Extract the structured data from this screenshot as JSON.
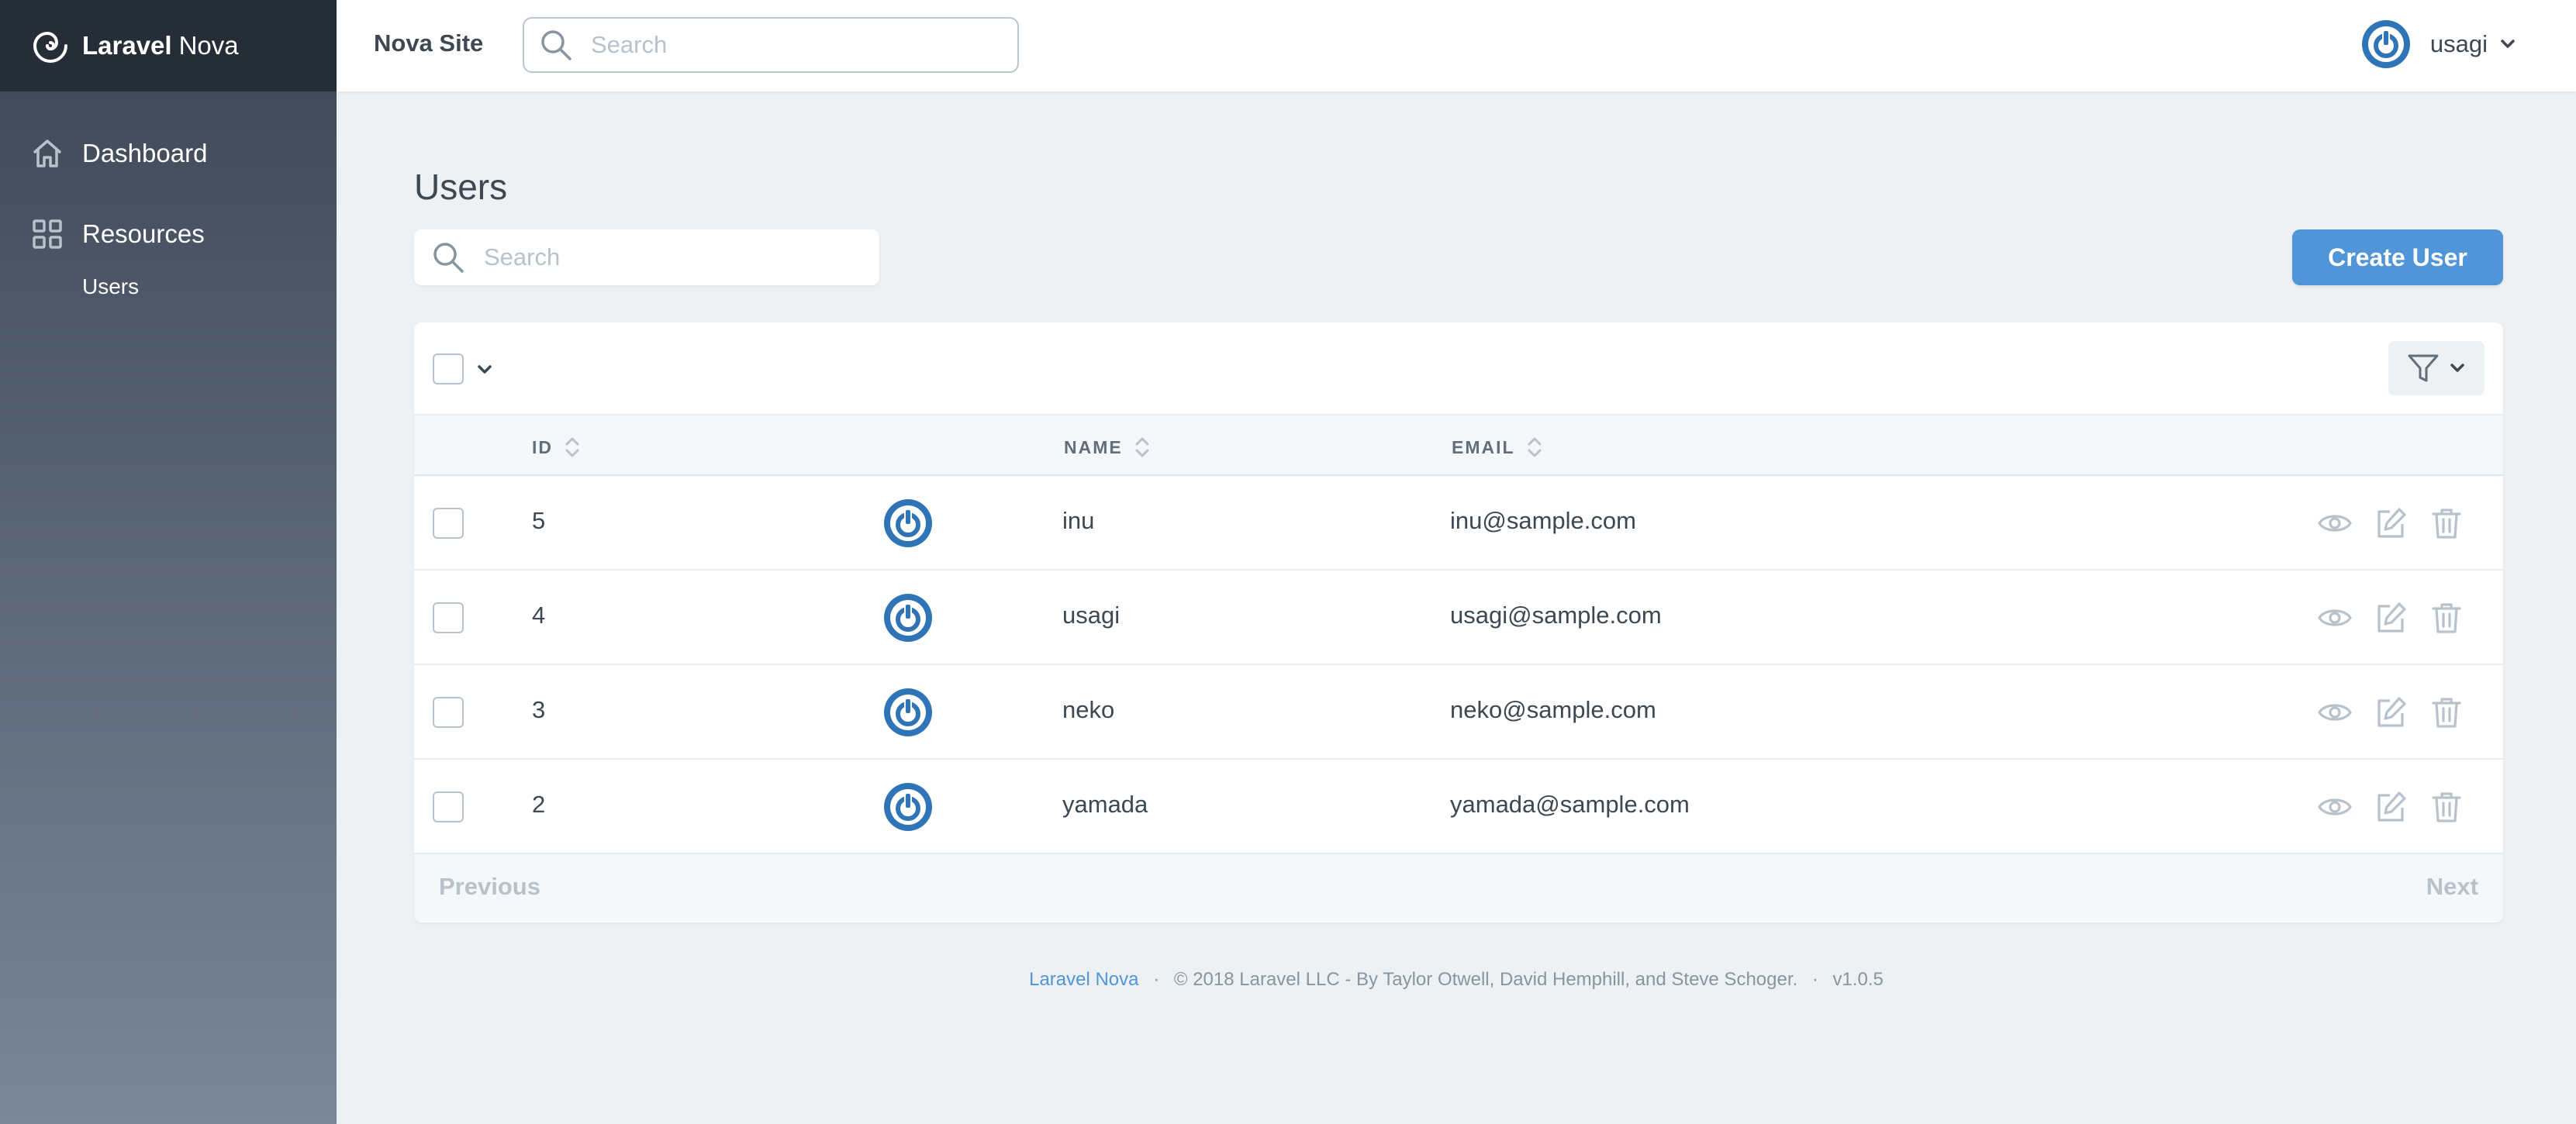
{
  "brand": {
    "name_bold": "Laravel",
    "name_light": "Nova"
  },
  "sidebar": {
    "items": [
      {
        "label": "Dashboard",
        "icon": "home-icon"
      },
      {
        "label": "Resources",
        "icon": "grid-icon"
      }
    ],
    "sub_items": [
      {
        "label": "Users"
      }
    ]
  },
  "header": {
    "site_name": "Nova Site",
    "search_placeholder": "Search",
    "user_name": "usagi"
  },
  "main": {
    "title": "Users",
    "search_placeholder": "Search",
    "create_label": "Create User",
    "columns": [
      "ID",
      "NAME",
      "EMAIL"
    ],
    "rows": [
      {
        "id": "5",
        "name": "inu",
        "email": "inu@sample.com"
      },
      {
        "id": "4",
        "name": "usagi",
        "email": "usagi@sample.com"
      },
      {
        "id": "3",
        "name": "neko",
        "email": "neko@sample.com"
      },
      {
        "id": "2",
        "name": "yamada",
        "email": "yamada@sample.com"
      }
    ],
    "pager": {
      "prev": "Previous",
      "next": "Next"
    }
  },
  "footer": {
    "link": "Laravel Nova",
    "dot1": "·",
    "copyright": "© 2018 Laravel LLC - By Taylor Otwell, David Hemphill, and Steve Schoger.",
    "dot2": "·",
    "version": "v1.0.5"
  },
  "colors": {
    "accent": "#4f95d8",
    "sidebar_top": "#3c4655",
    "brand_bg": "#252d37",
    "avatar": "#2f74b6"
  }
}
